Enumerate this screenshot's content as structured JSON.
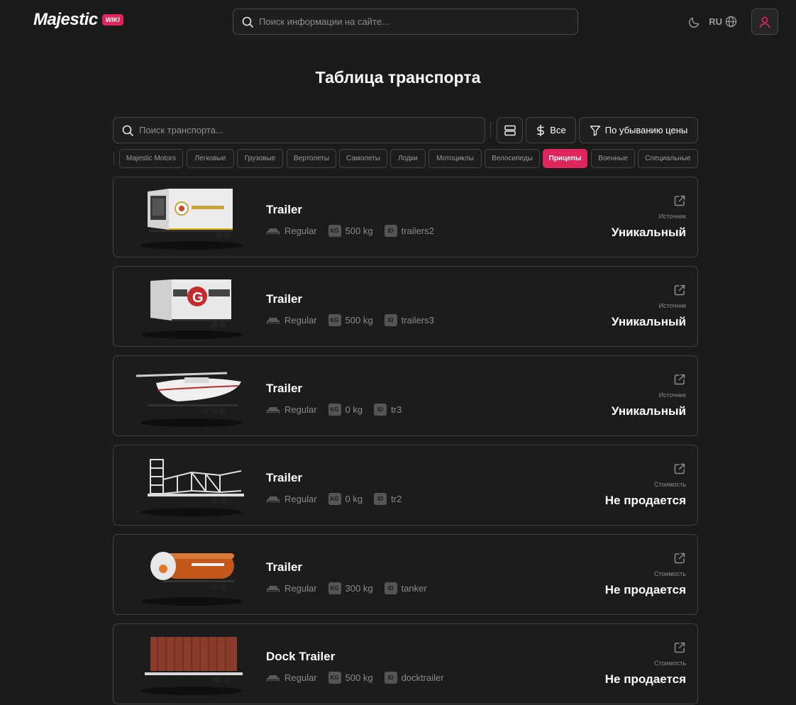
{
  "header": {
    "logo_text": "Majestic",
    "logo_badge": "WIKI",
    "search_placeholder": "Поиск информации на сайте...",
    "lang": "RU"
  },
  "page_title": "Таблица транспорта",
  "toolbar": {
    "search_placeholder": "Поиск транспорта...",
    "price_filter_label": "Все",
    "sort_label": "По убыванию цены"
  },
  "categories": [
    {
      "label": "Majestic Motors",
      "active": false
    },
    {
      "label": "Легковые",
      "active": false
    },
    {
      "label": "Грузовые",
      "active": false
    },
    {
      "label": "Вертолеты",
      "active": false
    },
    {
      "label": "Самолеты",
      "active": false
    },
    {
      "label": "Лодки",
      "active": false
    },
    {
      "label": "Мотоциклы",
      "active": false
    },
    {
      "label": "Велосипеды",
      "active": false
    },
    {
      "label": "Прицепы",
      "active": true
    },
    {
      "label": "Военные",
      "active": false
    },
    {
      "label": "Специальные",
      "active": false
    }
  ],
  "meta_tags": {
    "weight": "KG",
    "id": "ID"
  },
  "vehicles": [
    {
      "name": "Trailer",
      "type": "Regular",
      "weight": "500 kg",
      "id": "trailers2",
      "price_label": "Источник",
      "price_value": "Уникальный",
      "image": "refrigerated-trailer"
    },
    {
      "name": "Trailer",
      "type": "Regular",
      "weight": "500 kg",
      "id": "trailers3",
      "price_label": "Источник",
      "price_value": "Уникальный",
      "image": "box-trailer-big-goods"
    },
    {
      "name": "Trailer",
      "type": "Regular",
      "weight": "0 kg",
      "id": "tr3",
      "price_label": "Источник",
      "price_value": "Уникальный",
      "image": "boat-trailer"
    },
    {
      "name": "Trailer",
      "type": "Regular",
      "weight": "0 kg",
      "id": "tr2",
      "price_label": "Стоимость",
      "price_value": "Не продается",
      "image": "car-carrier-trailer"
    },
    {
      "name": "Trailer",
      "type": "Regular",
      "weight": "300 kg",
      "id": "tanker",
      "price_label": "Стоимость",
      "price_value": "Не продается",
      "image": "fuel-tanker-trailer"
    },
    {
      "name": "Dock Trailer",
      "type": "Regular",
      "weight": "500 kg",
      "id": "docktrailer",
      "price_label": "Стоимость",
      "price_value": "Не продается",
      "image": "container-trailer"
    }
  ],
  "colors": {
    "accent": "#e0245e",
    "background": "#1b1b1b",
    "card": "#1c1c1c",
    "border": "#3f3f3f"
  }
}
